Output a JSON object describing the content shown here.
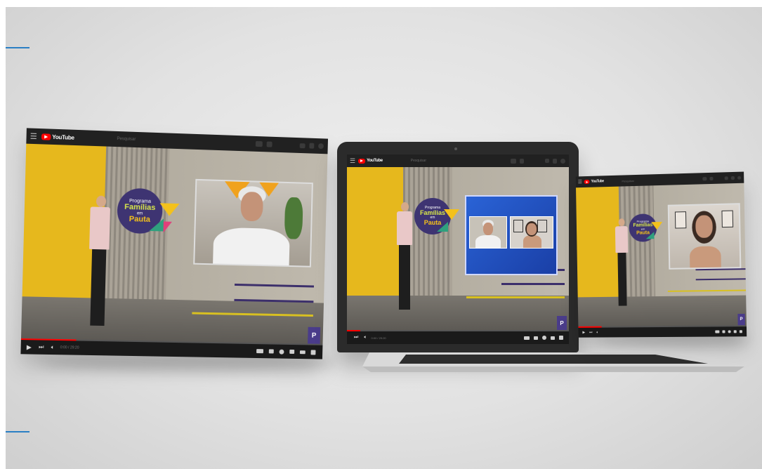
{
  "screens": {
    "left": {
      "brand": "YouTube",
      "search_placeholder": "Pesquisar",
      "time": "0:00 / 29:20",
      "show": {
        "l1": "Programa",
        "l2": "Famílias",
        "l3": "em",
        "l4": "Pauta"
      },
      "progress": 0.18
    },
    "center": {
      "brand": "YouTube",
      "search_placeholder": "Pesquisar",
      "time": "0:00 / 29:20",
      "show": {
        "l1": "Programa",
        "l2": "Famílias",
        "l3": "em",
        "l4": "Pauta"
      },
      "progress": 0.06
    },
    "right": {
      "brand": "YouTube",
      "search_placeholder": "Pesquisar",
      "show": {
        "l1": "Programa",
        "l2": "Famílias",
        "l3": "em",
        "l4": "Pauta"
      },
      "progress": 0.14
    }
  },
  "colors": {
    "yt_red": "#ff0000",
    "brand_purple": "#3e3472",
    "studio_yellow": "#e6b81d",
    "inset_blue": "#1f4fbf"
  },
  "icons": [
    "menu-icon",
    "play-icon",
    "next-icon",
    "volume-icon",
    "search-icon",
    "mic-icon",
    "video-camera-icon",
    "bell-icon",
    "settings-icon",
    "fullscreen-icon"
  ]
}
